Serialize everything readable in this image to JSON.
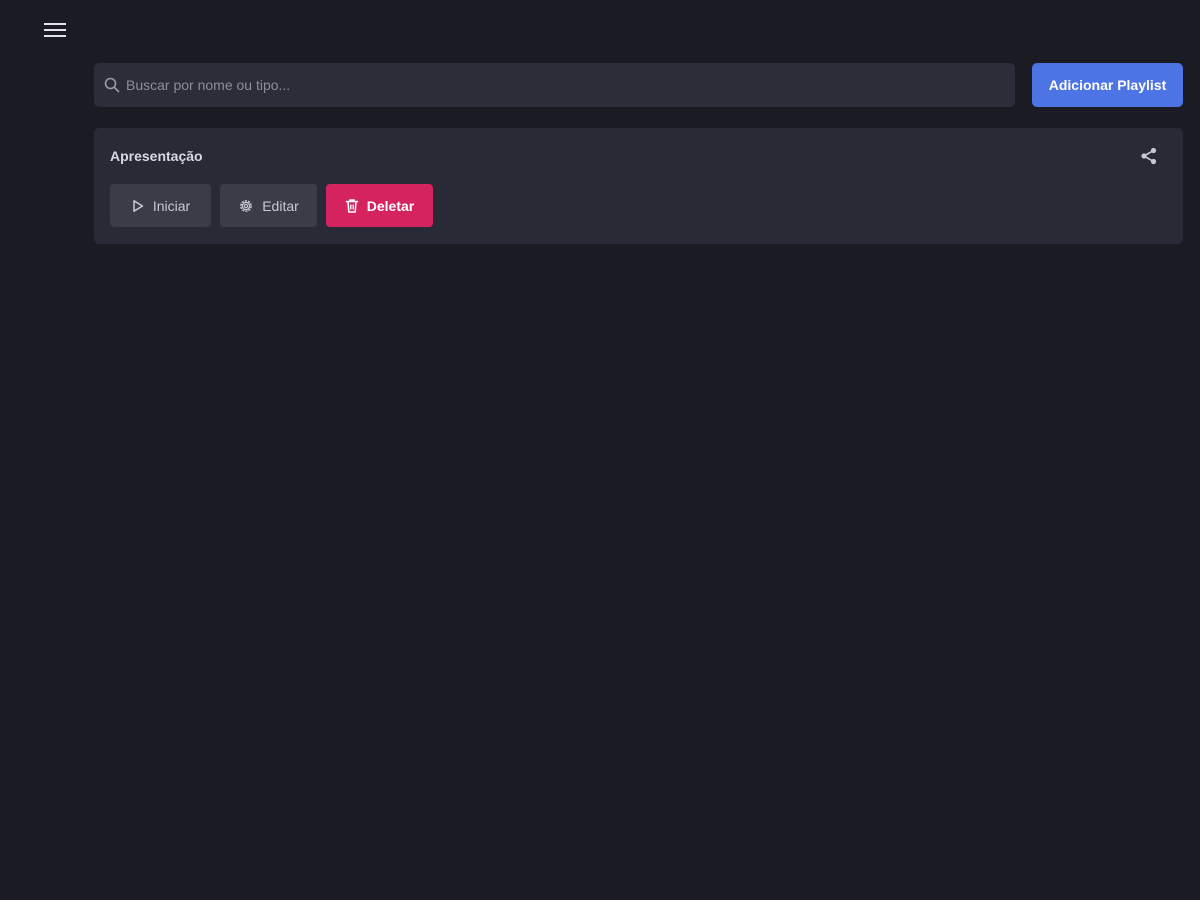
{
  "header": {
    "menu_icon": "hamburger-menu-icon"
  },
  "search": {
    "placeholder": "Buscar por nome ou tipo...",
    "value": "",
    "icon": "search-icon"
  },
  "toolbar": {
    "add_playlist_label": "Adicionar Playlist"
  },
  "playlists": [
    {
      "title": "Apresentação",
      "share_icon": "share-icon",
      "actions": {
        "start_label": "Iniciar",
        "edit_label": "Editar",
        "delete_label": "Deletar"
      }
    }
  ],
  "colors": {
    "background": "#1b1b24",
    "surface": "#2a2a36",
    "primary": "#4d74e4",
    "danger": "#d4235e"
  }
}
